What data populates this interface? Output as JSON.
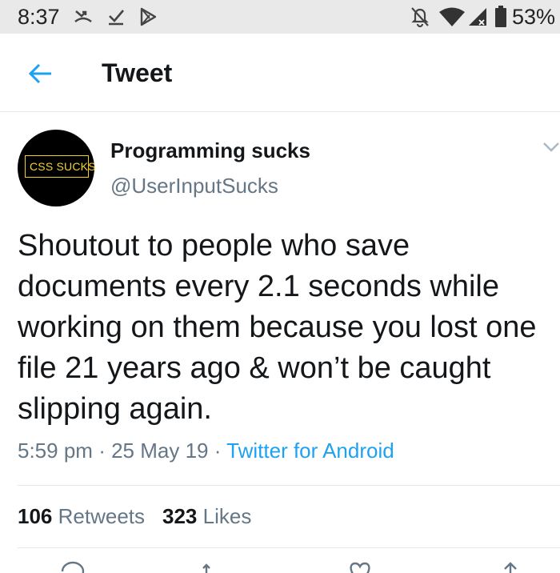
{
  "status_bar": {
    "time": "8:37",
    "battery": "53%",
    "icons_left": [
      "missed-call-icon",
      "download-done-icon",
      "play-store-icon"
    ],
    "icons_right": [
      "notifications-off-icon",
      "wifi-icon",
      "signal-icon",
      "battery-icon"
    ]
  },
  "header": {
    "title": "Tweet",
    "back_icon": "arrow-left-icon"
  },
  "tweet": {
    "avatar_text": "CSS SUCKS",
    "author_name": "Programming sucks",
    "author_handle": "@UserInputSucks",
    "text": "Shoutout to people who save documents every 2.1 seconds while working on them because you lost one file 21 years ago & won’t be caught slipping again.",
    "time": "5:59 pm",
    "date": "25 May 19",
    "source": "Twitter for Android",
    "separator": "·",
    "retweets_count": "106",
    "retweets_label": "Retweets",
    "likes_count": "323",
    "likes_label": "Likes"
  },
  "actions": [
    "reply-icon",
    "retweet-icon",
    "like-icon",
    "share-icon"
  ],
  "colors": {
    "accent": "#1da1f2",
    "secondary_text": "#657786",
    "primary_text": "#14171a",
    "status_bar_bg": "#e9e9e9",
    "avatar_text": "#f3d322"
  }
}
